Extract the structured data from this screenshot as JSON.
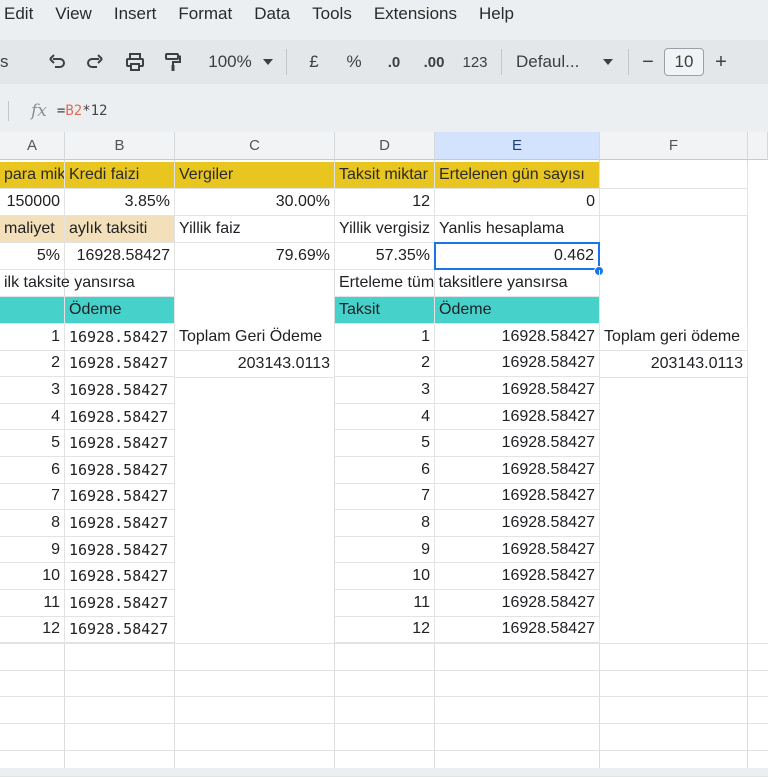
{
  "menu": [
    "Edit",
    "View",
    "Insert",
    "Format",
    "Data",
    "Tools",
    "Extensions",
    "Help"
  ],
  "toolbar": {
    "left_cut": "s",
    "zoom": "100%",
    "currency": "£",
    "percent": "%",
    "dec_decrease": ".0",
    "dec_increase": ".00",
    "number_format": "123",
    "font": "Defaul...",
    "minus": "−",
    "font_size": "10",
    "plus": "+"
  },
  "formula_bar": {
    "fx": "fx",
    "prefix": "=",
    "ref": "B2",
    "rest": "*12"
  },
  "columns": [
    "A",
    "B",
    "C",
    "D",
    "E",
    "F"
  ],
  "cells": {
    "r1": {
      "a": "para mikt",
      "b": "Kredi faizi",
      "c": "Vergiler",
      "d": "Taksit miktar",
      "e": "Ertelenen gün sayısı"
    },
    "r2": {
      "a": "150000",
      "b": "3.85%",
      "c": "30.00%",
      "d": "12",
      "e": "0"
    },
    "r3": {
      "a": "maliyet",
      "b": "aylık taksiti",
      "c": "Yillik faiz",
      "d": "Yillik vergisiz",
      "e": "Yanlis hesaplama"
    },
    "r4": {
      "a": "5%",
      "b": "16928.58427",
      "c": "79.69%",
      "d": "57.35%",
      "e": "0.462"
    },
    "r5": {
      "a": "ilk taksite yansırsa",
      "d": "Erteleme tüm taksitlere yansırsa"
    },
    "r6": {
      "b": "Ödeme",
      "d": "Taksit",
      "e": "Ödeme"
    },
    "r7": {
      "c": "Toplam Geri Ödeme",
      "f": "Toplam geri ödeme"
    },
    "r8": {
      "c": "203143.0113",
      "f": "203143.0113"
    }
  },
  "left_table": [
    {
      "n": "1",
      "v": "16928.58427"
    },
    {
      "n": "2",
      "v": "16928.58427"
    },
    {
      "n": "3",
      "v": "16928.58427"
    },
    {
      "n": "4",
      "v": "16928.58427"
    },
    {
      "n": "5",
      "v": "16928.58427"
    },
    {
      "n": "6",
      "v": "16928.58427"
    },
    {
      "n": "7",
      "v": "16928.58427"
    },
    {
      "n": "8",
      "v": "16928.58427"
    },
    {
      "n": "9",
      "v": "16928.58427"
    },
    {
      "n": "10",
      "v": "16928.58427"
    },
    {
      "n": "11",
      "v": "16928.58427"
    },
    {
      "n": "12",
      "v": "16928.58427"
    }
  ],
  "right_table": [
    {
      "n": "1",
      "v": "16928.58427"
    },
    {
      "n": "2",
      "v": "16928.58427"
    },
    {
      "n": "3",
      "v": "16928.58427"
    },
    {
      "n": "4",
      "v": "16928.58427"
    },
    {
      "n": "5",
      "v": "16928.58427"
    },
    {
      "n": "6",
      "v": "16928.58427"
    },
    {
      "n": "7",
      "v": "16928.58427"
    },
    {
      "n": "8",
      "v": "16928.58427"
    },
    {
      "n": "9",
      "v": "16928.58427"
    },
    {
      "n": "10",
      "v": "16928.58427"
    },
    {
      "n": "11",
      "v": "16928.58427"
    },
    {
      "n": "12",
      "v": "16928.58427"
    }
  ],
  "colors": {
    "header_yellow": "#e8c51f",
    "cyan": "#46d1cb",
    "tan": "#f3dfb9",
    "selection": "#1a73e8"
  }
}
